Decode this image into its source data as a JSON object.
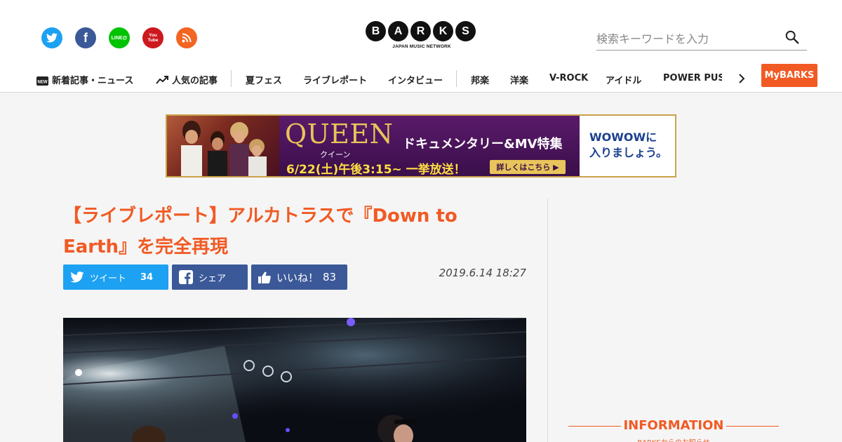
{
  "header": {
    "social": [
      {
        "name": "twitter-icon",
        "color": "#1da1f2"
      },
      {
        "name": "facebook-icon",
        "color": "#3b5998"
      },
      {
        "name": "line-icon",
        "label": "LINE@",
        "color": "#00c300"
      },
      {
        "name": "youtube-icon",
        "label": "You Tube",
        "color": "#cc181e"
      },
      {
        "name": "rss-icon",
        "color": "#f26522"
      }
    ],
    "logo": {
      "letters": [
        "B",
        "A",
        "R",
        "K",
        "S"
      ],
      "tagline": "JAPAN MUSIC NETWORK"
    },
    "search": {
      "placeholder": "検索キーワードを入力",
      "value": ""
    }
  },
  "nav": {
    "new_badge": "NEW",
    "items": [
      "新着記事・ニュース",
      "人気の記事",
      "夏フェス",
      "ライブレポート",
      "インタビュー",
      "邦楽",
      "洋楽",
      "V-ROCK",
      "アイドル",
      "POWER PUSH"
    ],
    "mybarks": "MyBARKS"
  },
  "banner": {
    "title": "QUEEN",
    "title_kana": "クイーン",
    "subtitle": "ドキュメンタリー&MV特集",
    "date_text": "6/22(土)午後3:15~ 一挙放送！",
    "cta": "詳しくはこちら ▶",
    "right_line1": "WOWOWに",
    "right_line2": "入りましょう。",
    "accent": "#e8c45a"
  },
  "article": {
    "title": "【ライブレポート】アルカトラスで『Down to Earth』を完全再現",
    "date": "2019.6.14 18:27",
    "share": {
      "tweet_label": "ツイート",
      "tweet_count": "34",
      "facebook_label": "シェア",
      "like_label": "いいね！",
      "like_count": "83"
    }
  },
  "sidebar": {
    "info_heading": "INFORMATION",
    "info_sub": "BARKSからのお知らせ"
  },
  "colors": {
    "brand_orange": "#f15a24",
    "twitter": "#1da1f2",
    "facebook": "#3b5998"
  }
}
